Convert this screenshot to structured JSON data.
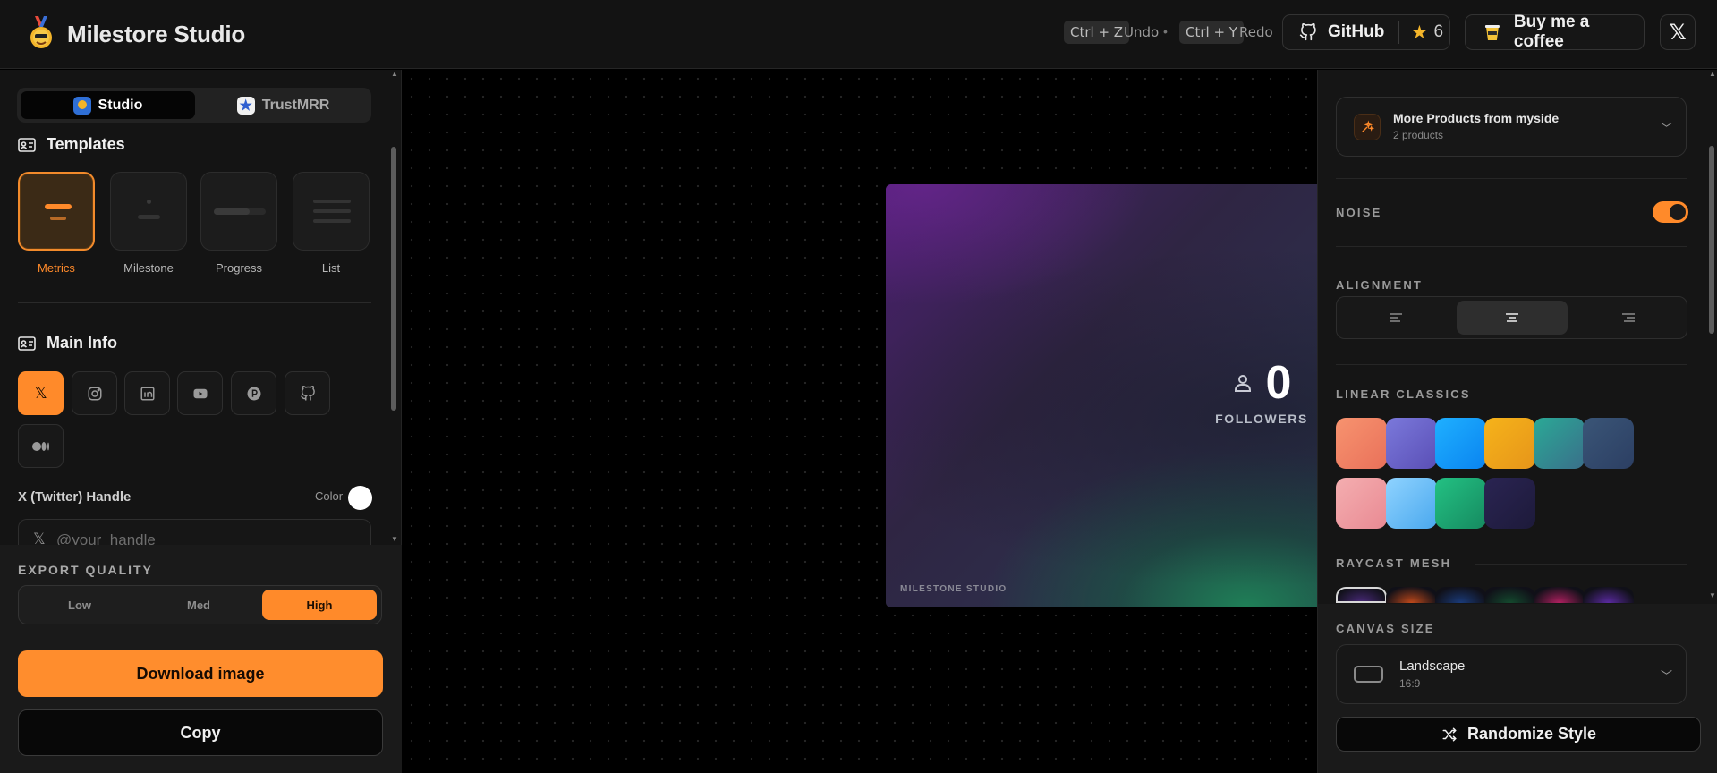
{
  "app": {
    "title": "Milestore Studio"
  },
  "topbar": {
    "undo_key": "Ctrl + Z",
    "undo_label": "Undo",
    "redo_key": "Ctrl + Y",
    "redo_label": "Redo",
    "github_label": "GitHub",
    "github_stars": "6",
    "coffee_label": "Buy me a coffee"
  },
  "left": {
    "tabs": [
      {
        "label": "Studio"
      },
      {
        "label": "TrustMRR"
      }
    ],
    "templates_heading": "Templates",
    "templates": [
      {
        "label": "Metrics"
      },
      {
        "label": "Milestone"
      },
      {
        "label": "Progress"
      },
      {
        "label": "List"
      }
    ],
    "main_info_heading": "Main Info",
    "socials": [
      "x",
      "instagram",
      "linkedin",
      "youtube",
      "producthunt",
      "github",
      "medium"
    ],
    "handle_label": "X (Twitter) Handle",
    "color_label": "Color",
    "handle_placeholder": "@your_handle",
    "handle_value": ""
  },
  "export": {
    "title": "EXPORT QUALITY",
    "qualities": [
      "Low",
      "Med",
      "High"
    ],
    "selected_quality": "High",
    "download_label": "Download image",
    "copy_label": "Copy"
  },
  "preview": {
    "metric_value": "0",
    "metric_label": "FOLLOWERS",
    "watermark": "MILESTONE STUDIO"
  },
  "right": {
    "products_title": "More Products from myside",
    "products_count": "2 products",
    "noise_label": "NOISE",
    "noise_on": true,
    "alignment_label": "ALIGNMENT",
    "alignment_selected": "center",
    "linear_label": "LINEAR CLASSICS",
    "linear_swatches": [
      {
        "from": "#f7936f",
        "to": "#e9715a"
      },
      {
        "from": "#7b79db",
        "to": "#5a4fb6"
      },
      {
        "from": "#1fb0ff",
        "to": "#0a84f0"
      },
      {
        "from": "#f6b31a",
        "to": "#e6951a"
      },
      {
        "from": "#2aa996",
        "to": "#3a6f8a"
      },
      {
        "from": "#3a5577",
        "to": "#2c3f63"
      },
      {
        "from": "#f4aeb0",
        "to": "#e98a93"
      },
      {
        "from": "#8fd3ff",
        "to": "#4aa8ee"
      },
      {
        "from": "#23c183",
        "to": "#168a60"
      },
      {
        "from": "#2a2452",
        "to": "#1d1a3a"
      }
    ],
    "mesh_label": "RAYCAST MESH",
    "mesh_swatches": [
      "#4a2a7a",
      "#c0491a",
      "#1a3b7a",
      "#144a2e",
      "#b02060",
      "#5a2aa0"
    ],
    "canvas_size_label": "CANVAS SIZE",
    "canvas_size_value": "Landscape",
    "canvas_size_ratio": "16:9",
    "randomize_label": "Randomize Style"
  },
  "colors": {
    "accent": "#ff8a2a",
    "background": "#000000",
    "panel": "#141414"
  }
}
